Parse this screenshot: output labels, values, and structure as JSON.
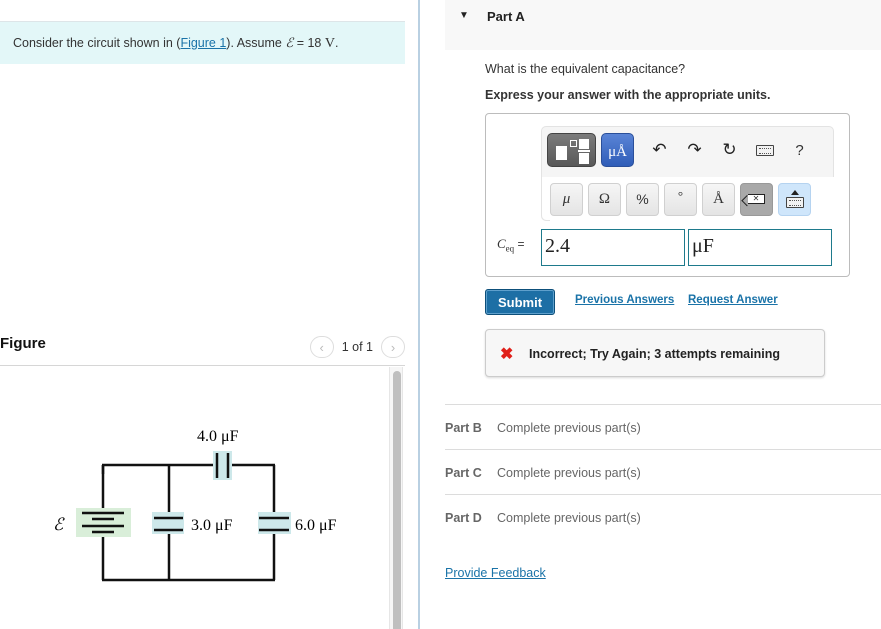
{
  "problem": {
    "prompt_prefix": "Consider the circuit shown in (",
    "figure_link": "Figure 1",
    "prompt_middle": "). Assume ",
    "emf_symbol": "ℰ",
    "emf_value": " = 18 ",
    "emf_unit": "V",
    "prompt_suffix": "."
  },
  "figure": {
    "title": "Figure",
    "pager_text": "1 of 1",
    "prev_icon": "chevron-left-icon",
    "next_icon": "chevron-right-icon",
    "circuit": {
      "emf_label": "ℰ",
      "c_top_label": "4.0 μF",
      "c_middle_label": "3.0 μF",
      "c_right_label": "6.0 μF",
      "battery_color": "#d9eed9",
      "capacitor_color": "#cde8ea"
    }
  },
  "part_a": {
    "title": "Part A",
    "question": "What is the equivalent capacitance?",
    "instruction": "Express your answer with the appropriate units.",
    "toolbar": {
      "units_button": "μÅ",
      "help": "?",
      "symbols": [
        "μ",
        "Ω",
        "%",
        "°",
        "Å"
      ]
    },
    "variable": "C",
    "variable_sub": "eq",
    "equals": " =",
    "answer_value": "2.4",
    "answer_unit": "μF",
    "submit_label": "Submit",
    "previous_answers_label": "Previous Answers",
    "request_answer_label": "Request Answer",
    "feedback_icon": "✖",
    "feedback_message": "Incorrect; Try Again; 3 attempts remaining"
  },
  "other_parts": [
    {
      "label": "Part B",
      "status": "Complete previous part(s)"
    },
    {
      "label": "Part C",
      "status": "Complete previous part(s)"
    },
    {
      "label": "Part D",
      "status": "Complete previous part(s)"
    }
  ],
  "provide_feedback_label": "Provide Feedback",
  "colors": {
    "accent": "#1d6fa5",
    "link": "#1a73a8",
    "error": "#e0201a",
    "prompt_bg": "#e3f7f8"
  }
}
